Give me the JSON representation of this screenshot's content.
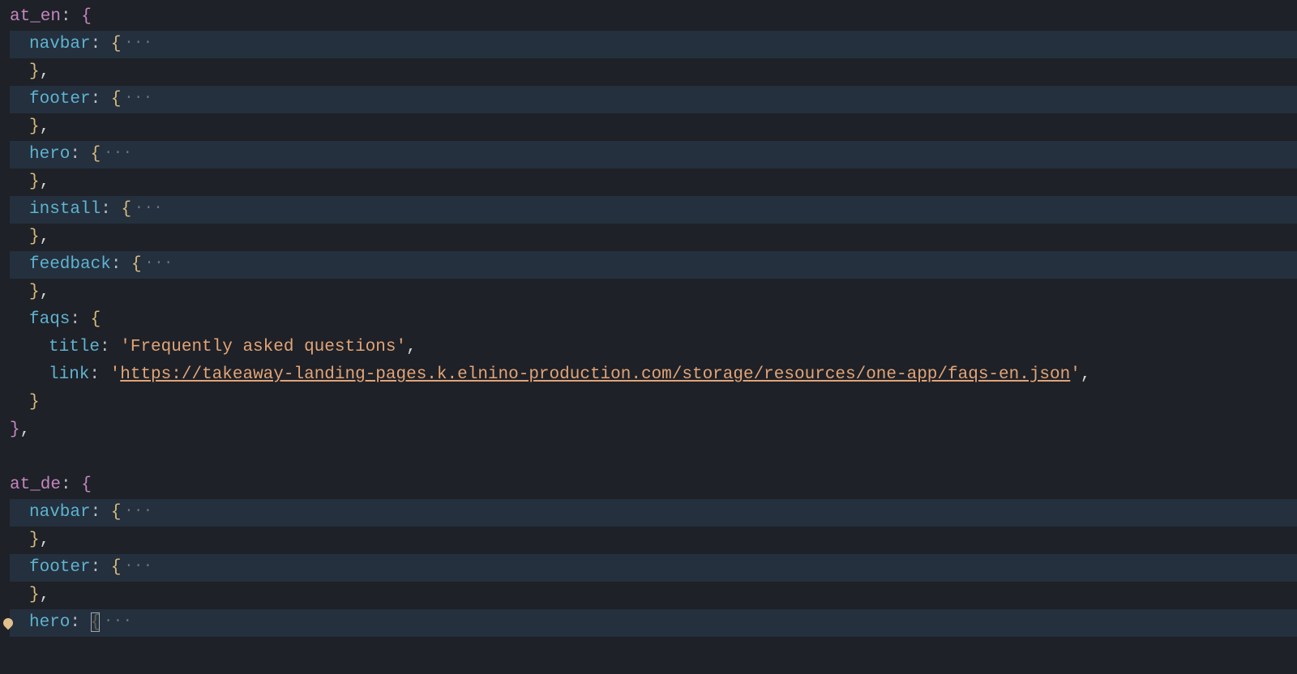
{
  "code": {
    "root1": "at_en",
    "root2": "at_de",
    "keys": {
      "navbar": "navbar",
      "footer": "footer",
      "hero": "hero",
      "install": "install",
      "feedback": "feedback",
      "faqs": "faqs",
      "title": "title",
      "link": "link"
    },
    "strings": {
      "faqs_title": "'Frequently asked questions'",
      "faqs_link_quote_open": "'",
      "faqs_link_url": "https://takeaway-landing-pages.k.elnino-production.com/storage/resources/one-app/faqs-en.json",
      "faqs_link_quote_close": "'"
    },
    "fold": "···"
  }
}
